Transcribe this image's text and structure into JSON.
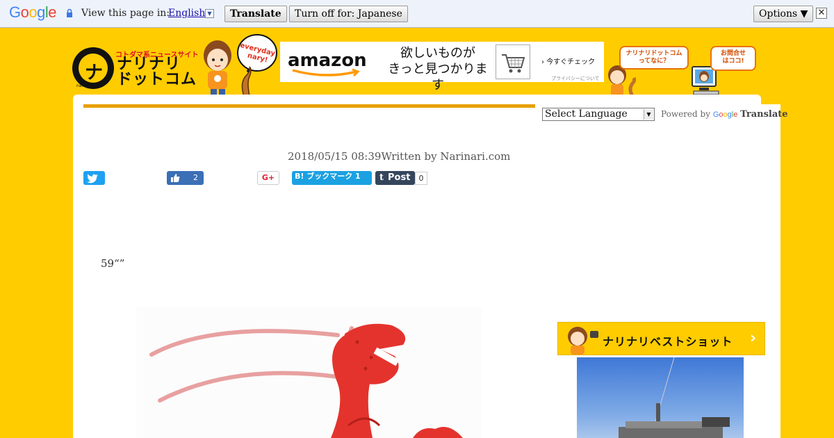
{
  "translate_bar": {
    "view_text": "View this page in:",
    "language": "English",
    "translate_button": "Translate",
    "turn_off_button": "Turn off for: Japanese",
    "options_button": "Options ▼",
    "close": "✕"
  },
  "header": {
    "logo_tagline": "コトダマ系ニュースサイト",
    "logo_line1": "ナリナリ",
    "logo_line2": "ドットコム",
    "logo_url": "narinari.com",
    "mascot_bubble": "everyday nary!",
    "ad": {
      "brand": "amazon",
      "copy_line1": "欲しいものが",
      "copy_line2": "きっと見つかります",
      "cta": "今すぐチェック",
      "privacy": "プライバシーについて"
    },
    "what_is_line1": "ナリナリドットコム",
    "what_is_line2": "ってなに？",
    "contact_line1": "お問合せ",
    "contact_line2": "はココ!"
  },
  "language_widget": {
    "select_label": "Select Language",
    "powered_by": "Powered by",
    "google": "Google",
    "translate": "Translate"
  },
  "article": {
    "dateline": "2018/05/15 08:39Written by Narinari.com",
    "body": "59“”"
  },
  "share": {
    "facebook_count": "2",
    "google_plus": "G+",
    "hatena_label": "B! ブックマーク 1",
    "tumblr_label": "Post",
    "tumblr_count": "0"
  },
  "sidebar": {
    "best_shot_label": "ナリナリベストショット",
    "best_shot_chevron": "›"
  },
  "colors": {
    "brand_yellow": "#ffcc00",
    "accent_orange": "#e8a000",
    "twitter": "#1da1f2",
    "facebook": "#3b6fb6",
    "hatena": "#1ba1e2",
    "tumblr": "#35465c"
  },
  "icons": [
    "lock-icon",
    "google-logo",
    "close-icon",
    "twitter-icon",
    "like-icon",
    "cart-icon",
    "lobster-illustration"
  ]
}
